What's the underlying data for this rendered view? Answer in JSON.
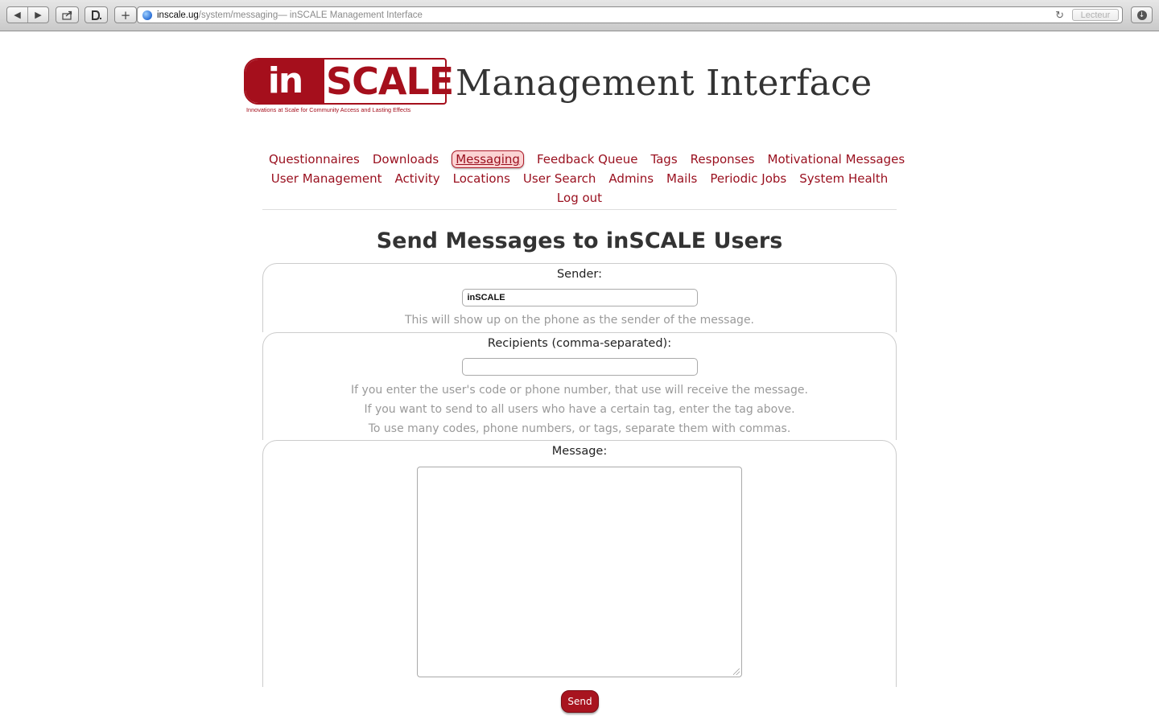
{
  "browser": {
    "url_host": "inscale.ug",
    "url_path": "/system/messaging",
    "url_title": " — inSCALE Management Interface",
    "reader_label": "Lecteur",
    "back_icon": "◀",
    "forward_icon": "▶",
    "add_icon": "+",
    "reload_icon": "↻"
  },
  "header": {
    "logo_in": "in",
    "logo_scale": "SCALE",
    "logo_tagline": "Innovations at Scale for Community Access and Lasting Effects",
    "site_title": "Management Interface"
  },
  "nav": {
    "row1": [
      "Questionnaires",
      "Downloads",
      "Messaging",
      "Feedback Queue",
      "Tags",
      "Responses",
      "Motivational Messages"
    ],
    "row2": [
      "User Management",
      "Activity",
      "Locations",
      "User Search",
      "Admins",
      "Mails",
      "Periodic Jobs",
      "System Health"
    ],
    "row3": [
      "Log out"
    ],
    "active": "Messaging"
  },
  "main": {
    "title": "Send Messages to inSCALE Users",
    "sender": {
      "label": "Sender:",
      "value": "inSCALE",
      "help": "This will show up on the phone as the sender of the message."
    },
    "recipients": {
      "label": "Recipients (comma-separated):",
      "value": "",
      "help": [
        "If you enter the user's code or phone number, that use will receive the message.",
        "If you want to send to all users who have a certain tag, enter the tag above.",
        "To use many codes, phone numbers, or tags, separate them with commas."
      ]
    },
    "message": {
      "label": "Message:",
      "value": ""
    },
    "send_label": "Send"
  },
  "colors": {
    "brand": "#a50f1c",
    "nav_link": "#990f1e",
    "active_bg": "#fbd3d3"
  }
}
